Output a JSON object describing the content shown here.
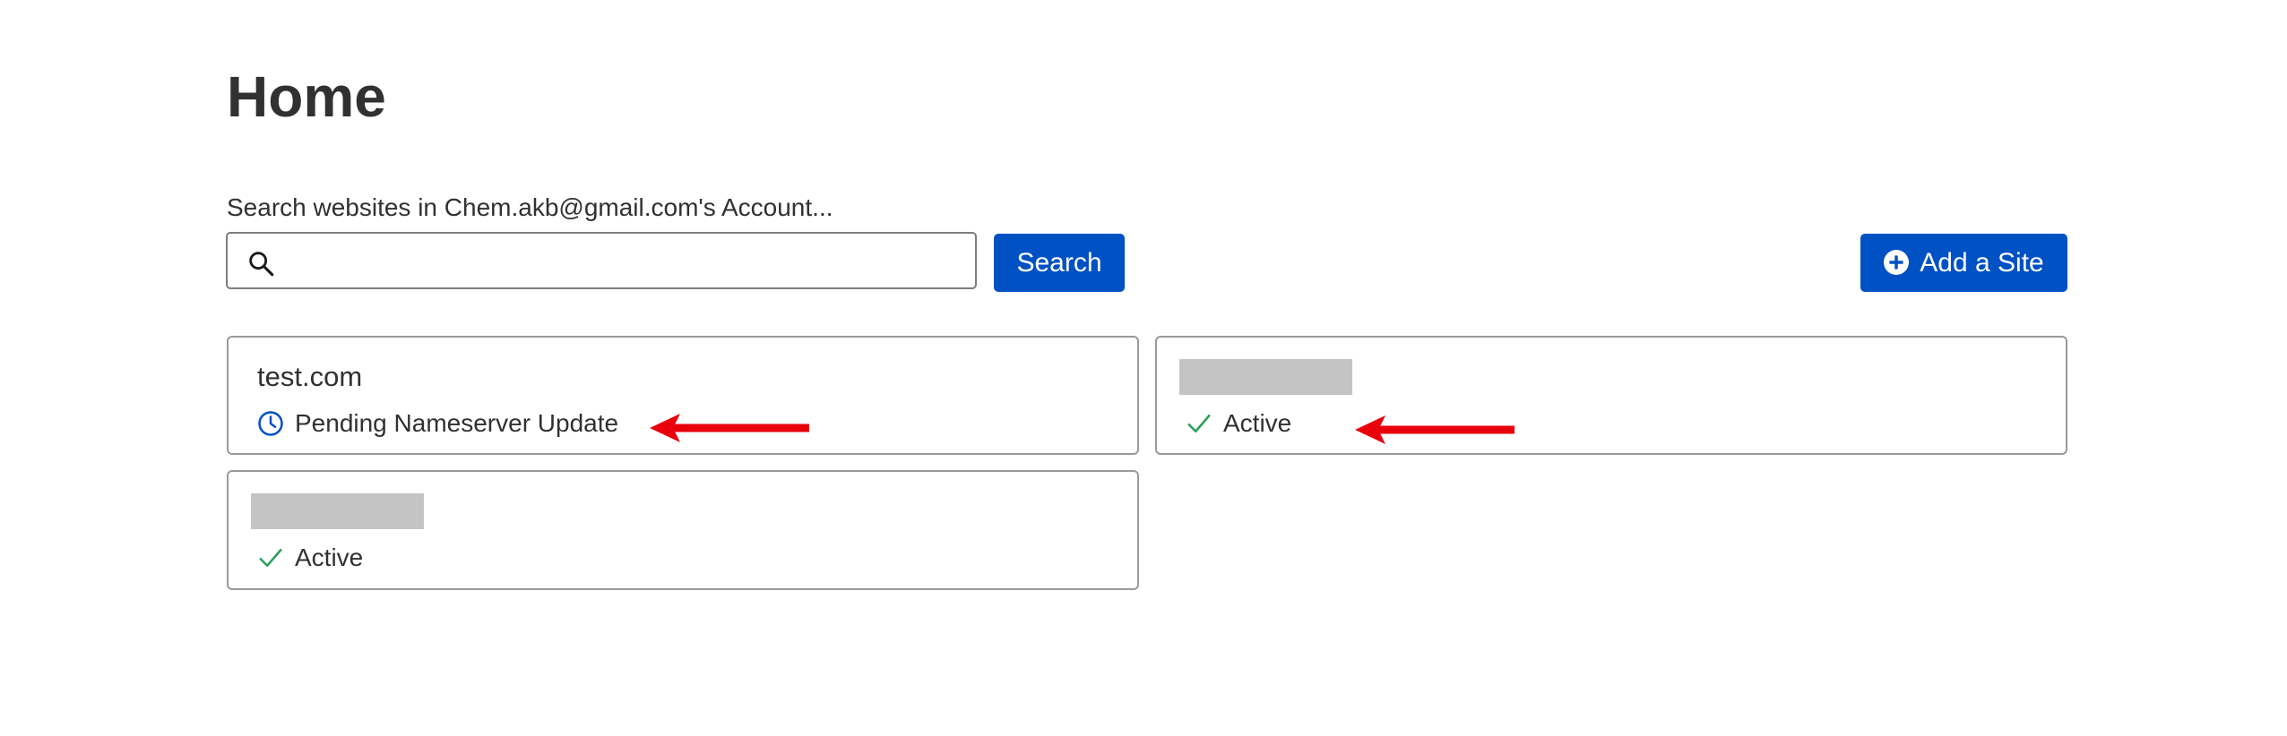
{
  "page": {
    "title": "Home"
  },
  "search": {
    "label": "Search websites in Chem.akb@gmail.com's Account...",
    "value": "",
    "placeholder": "",
    "button_label": "Search",
    "icon": "search-icon"
  },
  "toolbar": {
    "add_site_label": "Add a Site",
    "add_site_icon": "plus-circle-icon"
  },
  "sites": [
    {
      "domain": "test.com",
      "redacted": false,
      "status": "Pending Nameserver Update",
      "status_icon": "clock-icon",
      "status_color": "#0051c3",
      "annotated": true
    },
    {
      "domain": "",
      "redacted": true,
      "status": "Active",
      "status_icon": "checkmark-icon",
      "status_color": "#2c9d5a",
      "annotated": true
    },
    {
      "domain": "",
      "redacted": true,
      "status": "Active",
      "status_icon": "checkmark-icon",
      "status_color": "#2c9d5a",
      "annotated": false
    }
  ],
  "colors": {
    "primary_button": "#0051c3",
    "card_border": "#9a9a9a",
    "redaction": "#c4c4c4",
    "annotation_arrow": "#e8000b",
    "text": "#313131"
  }
}
